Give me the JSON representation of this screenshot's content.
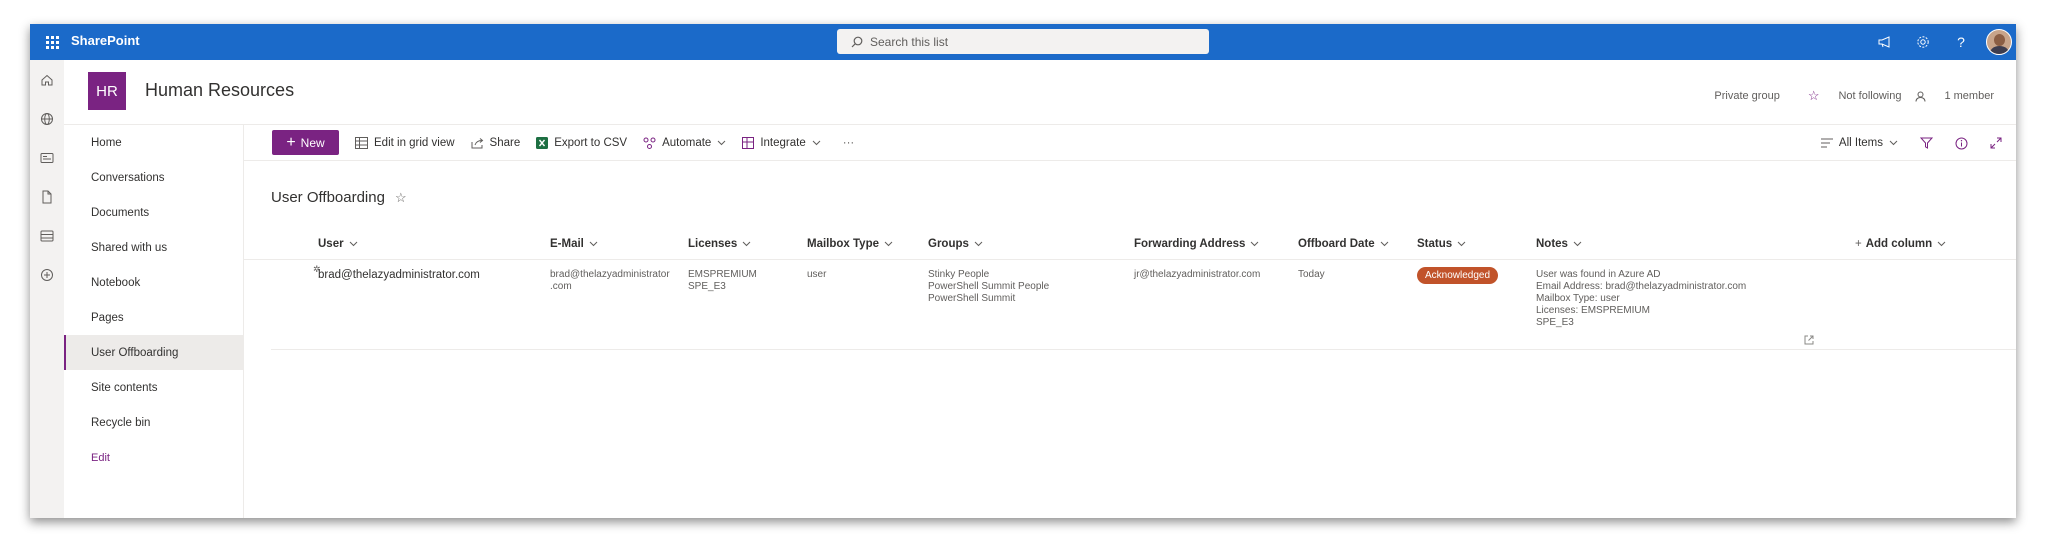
{
  "suite": {
    "app_name": "SharePoint",
    "search_placeholder": "Search this list"
  },
  "site": {
    "logo_text": "HR",
    "title": "Human Resources",
    "privacy": "Private group",
    "follow": "Not following",
    "members": "1 member"
  },
  "nav": {
    "items": [
      {
        "label": "Home"
      },
      {
        "label": "Conversations"
      },
      {
        "label": "Documents"
      },
      {
        "label": "Shared with us"
      },
      {
        "label": "Notebook"
      },
      {
        "label": "Pages"
      },
      {
        "label": "User Offboarding",
        "active": true
      },
      {
        "label": "Site contents"
      },
      {
        "label": "Recycle bin"
      }
    ],
    "edit_label": "Edit"
  },
  "toolbar": {
    "new_label": "New",
    "edit_grid_label": "Edit in grid view",
    "share_label": "Share",
    "export_label": "Export to CSV",
    "automate_label": "Automate",
    "integrate_label": "Integrate",
    "more_label": "···",
    "view_label": "All Items"
  },
  "list": {
    "title": "User Offboarding",
    "columns": [
      {
        "label": "User"
      },
      {
        "label": "E-Mail"
      },
      {
        "label": "Licenses"
      },
      {
        "label": "Mailbox Type"
      },
      {
        "label": "Groups"
      },
      {
        "label": "Forwarding Address"
      },
      {
        "label": "Offboard Date"
      },
      {
        "label": "Status"
      },
      {
        "label": "Notes"
      }
    ],
    "add_column_label": "Add column",
    "rows": [
      {
        "user": "brad@thelazyadministrator.com",
        "email_line1": "brad@thelazyadministrator",
        "email_line2": ".com",
        "licenses_line1": "EMSPREMIUM",
        "licenses_line2": "SPE_E3",
        "mailbox_type": "user",
        "groups_line1": "Stinky People",
        "groups_line2": "PowerShell Summit People",
        "groups_line3": "PowerShell Summit",
        "forwarding": "jr@thelazyadministrator.com",
        "offboard_date": "Today",
        "status": "Acknowledged",
        "notes_line1": "User was found in Azure AD",
        "notes_line2": "Email Address: brad@thelazyadministrator.com",
        "notes_line3": "Mailbox Type: user",
        "notes_line4": "Licenses: EMSPREMIUM",
        "notes_line5": "SPE_E3"
      }
    ]
  },
  "colors": {
    "suite_bar": "#1b6ac9",
    "brand_purple": "#7a2382",
    "status_acknowledged": "#c1532a"
  }
}
